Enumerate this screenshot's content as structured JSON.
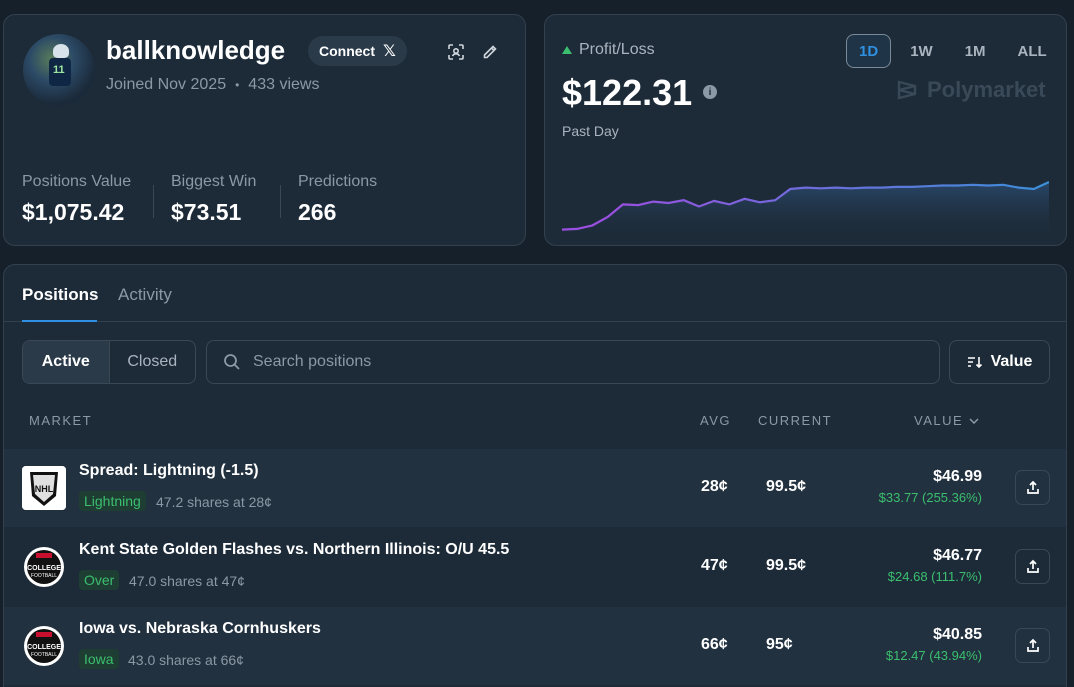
{
  "profile": {
    "username": "ballknowledge",
    "connect_label": "Connect",
    "joined": "Joined Nov 2025",
    "views": "433 views",
    "stats": [
      {
        "label": "Positions Value",
        "value": "$1,075.42"
      },
      {
        "label": "Biggest Win",
        "value": "$73.51"
      },
      {
        "label": "Predictions",
        "value": "266"
      }
    ]
  },
  "pnl": {
    "label": "Profit/Loss",
    "value": "$122.31",
    "period": "Past Day",
    "ranges": [
      "1D",
      "1W",
      "1M",
      "ALL"
    ],
    "active_range": "1D",
    "brand": "Polymarket",
    "series": [
      0.02,
      0.03,
      0.08,
      0.2,
      0.38,
      0.37,
      0.42,
      0.4,
      0.44,
      0.35,
      0.43,
      0.38,
      0.46,
      0.41,
      0.44,
      0.6,
      0.62,
      0.61,
      0.62,
      0.61,
      0.62,
      0.62,
      0.63,
      0.63,
      0.64,
      0.65,
      0.65,
      0.66,
      0.65,
      0.66,
      0.62,
      0.6,
      0.7
    ],
    "colors": {
      "up": "#3bbf6e",
      "line": "#3b8fd8",
      "line_start": "#9a4fe0"
    }
  },
  "tabs": {
    "positions": "Positions",
    "activity": "Activity"
  },
  "filters": {
    "active": "Active",
    "closed": "Closed",
    "search_placeholder": "Search positions",
    "sort_label": "Value"
  },
  "columns": {
    "market": "MARKET",
    "avg": "AVG",
    "current": "CURRENT",
    "value": "VALUE"
  },
  "rows": [
    {
      "title": "Spread: Lightning (-1.5)",
      "outcome": "Lightning",
      "shares": "47.2 shares at 28¢",
      "avg": "28¢",
      "current": "99.5¢",
      "value": "$46.99",
      "gain": "$33.77 (255.36%)",
      "logo": "nhl-logo"
    },
    {
      "title": "Kent State Golden Flashes vs. Northern Illinois: O/U 45.5",
      "outcome": "Over",
      "shares": "47.0 shares at 47¢",
      "avg": "47¢",
      "current": "99.5¢",
      "value": "$46.77",
      "gain": "$24.68 (111.7%)",
      "logo": "college-football-logo"
    },
    {
      "title": "Iowa vs. Nebraska Cornhuskers",
      "outcome": "Iowa",
      "shares": "43.0 shares at 66¢",
      "avg": "66¢",
      "current": "95¢",
      "value": "$40.85",
      "gain": "$12.47 (43.94%)",
      "logo": "college-football-logo"
    }
  ]
}
